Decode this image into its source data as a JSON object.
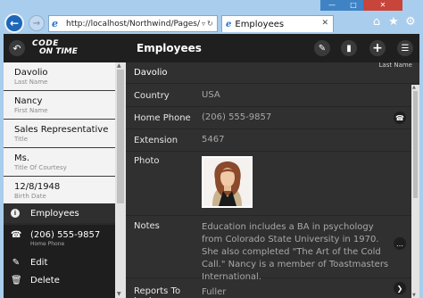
{
  "browser": {
    "url": "http://localhost/Northwind/Pages/E",
    "tab_title": "Employees",
    "window_controls": [
      "minimize",
      "maximize",
      "close"
    ],
    "toolbar_icons": [
      "home-icon",
      "star-icon",
      "gear-icon"
    ]
  },
  "app": {
    "logo_line1": "CODE",
    "logo_line2": "ON TIME",
    "page_title": "Employees",
    "record_title": "Davolio",
    "sort_label": "Last Name"
  },
  "sidebar": {
    "items": [
      {
        "value": "Davolio",
        "label": "Last Name"
      },
      {
        "value": "Nancy",
        "label": "First Name"
      },
      {
        "value": "Sales Representative",
        "label": "Title"
      },
      {
        "value": "Ms.",
        "label": "Title Of Courtesy"
      },
      {
        "value": "12/8/1948",
        "label": "Birth Date"
      }
    ],
    "active_item": "Employees",
    "actions": [
      {
        "value": "(206) 555-9857",
        "label": "Home Phone",
        "icon": "phone-icon"
      },
      {
        "value": "Edit",
        "label": "",
        "icon": "pencil-icon"
      },
      {
        "value": "Delete",
        "label": "",
        "icon": "trash-icon"
      }
    ]
  },
  "form": {
    "fields": [
      {
        "label": "Country",
        "value": "USA"
      },
      {
        "label": "Home Phone",
        "value": "(206) 555-9857"
      },
      {
        "label": "Extension",
        "value": "5467"
      },
      {
        "label": "Photo",
        "value": ""
      },
      {
        "label": "Notes",
        "value": "Education includes a BA in psychology from Colorado State University in 1970. She also completed \"The Art of the Cold Call.\" Nancy is a member of Toastmasters International."
      },
      {
        "label": "Reports To Last",
        "value": "Fuller"
      }
    ]
  }
}
